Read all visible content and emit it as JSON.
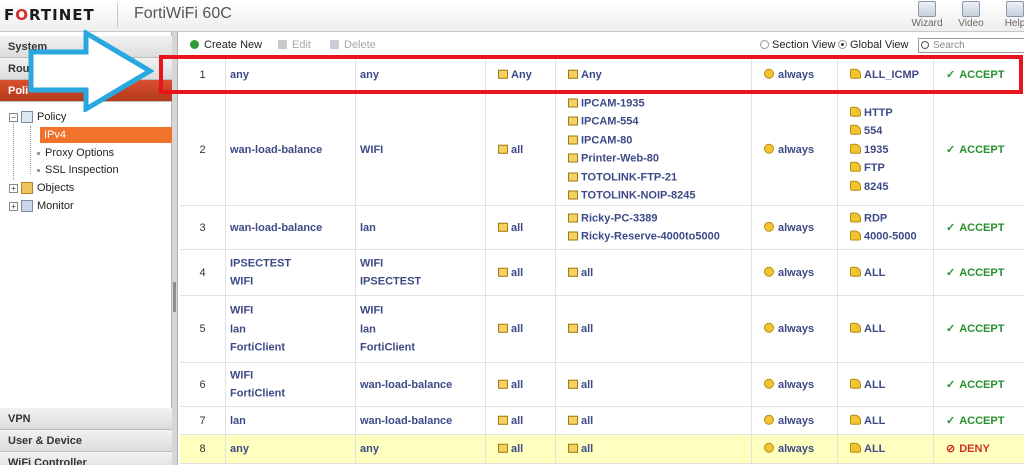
{
  "header": {
    "logo_prefix": "F",
    "logo_rest": "RTINET",
    "logo_mid": "",
    "device_name": "FortiWiFi 60C",
    "buttons": {
      "wizard": "Wizard",
      "video": "Video",
      "help": "Help"
    }
  },
  "sidebar": {
    "sections": {
      "system": "System",
      "router": "Rou",
      "policy": "Poli",
      "vpn": "VPN",
      "user_device": "User & Device",
      "wifi": "WiFi Controller"
    },
    "tree": {
      "policy": "Policy",
      "ipv4": "IPv4",
      "proxy": "Proxy Options",
      "ssl": "SSL Inspection",
      "objects": "Objects",
      "monitor": "Monitor"
    }
  },
  "toolbar": {
    "create": "Create New",
    "edit": "Edit",
    "delete": "Delete",
    "section_view": "Section View",
    "global_view": "Global View",
    "search_placeholder": "Search"
  },
  "policies": [
    {
      "id": "1",
      "src": [
        "any"
      ],
      "dst": [
        "any"
      ],
      "src_addr": [
        "Any"
      ],
      "dst_addr": [
        "Any"
      ],
      "schedule": "always",
      "service": [
        "ALL_ICMP"
      ],
      "action": "ACCEPT"
    },
    {
      "id": "2",
      "src": [
        "wan-load-balance"
      ],
      "dst": [
        "WIFI"
      ],
      "src_addr": [
        "all"
      ],
      "dst_addr": [
        "IPCAM-1935",
        "IPCAM-554",
        "IPCAM-80",
        "Printer-Web-80",
        "TOTOLINK-FTP-21",
        "TOTOLINK-NOIP-8245"
      ],
      "schedule": "always",
      "service": [
        "HTTP",
        "554",
        "1935",
        "FTP",
        "8245"
      ],
      "action": "ACCEPT"
    },
    {
      "id": "3",
      "src": [
        "wan-load-balance"
      ],
      "dst": [
        "lan"
      ],
      "src_addr": [
        "all"
      ],
      "dst_addr": [
        "Ricky-PC-3389",
        "Ricky-Reserve-4000to5000"
      ],
      "schedule": "always",
      "service": [
        "RDP",
        "4000-5000"
      ],
      "action": "ACCEPT"
    },
    {
      "id": "4",
      "src": [
        "IPSECTEST",
        "WIFI"
      ],
      "dst": [
        "WIFI",
        "IPSECTEST"
      ],
      "src_addr": [
        "all"
      ],
      "dst_addr": [
        "all"
      ],
      "schedule": "always",
      "service": [
        "ALL"
      ],
      "action": "ACCEPT"
    },
    {
      "id": "5",
      "src": [
        "WIFI",
        "lan",
        "FortiClient"
      ],
      "dst": [
        "WIFI",
        "lan",
        "FortiClient"
      ],
      "src_addr": [
        "all"
      ],
      "dst_addr": [
        "all"
      ],
      "schedule": "always",
      "service": [
        "ALL"
      ],
      "action": "ACCEPT"
    },
    {
      "id": "6",
      "src": [
        "WIFI",
        "FortiClient"
      ],
      "dst": [
        "wan-load-balance"
      ],
      "src_addr": [
        "all"
      ],
      "dst_addr": [
        "all"
      ],
      "schedule": "always",
      "service": [
        "ALL"
      ],
      "action": "ACCEPT"
    },
    {
      "id": "7",
      "src": [
        "lan"
      ],
      "dst": [
        "wan-load-balance"
      ],
      "src_addr": [
        "all"
      ],
      "dst_addr": [
        "all"
      ],
      "schedule": "always",
      "service": [
        "ALL"
      ],
      "action": "ACCEPT"
    },
    {
      "id": "8",
      "src": [
        "any"
      ],
      "dst": [
        "any"
      ],
      "src_addr": [
        "all"
      ],
      "dst_addr": [
        "all"
      ],
      "schedule": "always",
      "service": [
        "ALL"
      ],
      "action": "DENY"
    }
  ],
  "colors": {
    "accept": "#27912e",
    "deny": "#d2301f",
    "highlight": "#e8141d",
    "arrow": "#29a8e0",
    "active_nav": "#c4472a"
  }
}
